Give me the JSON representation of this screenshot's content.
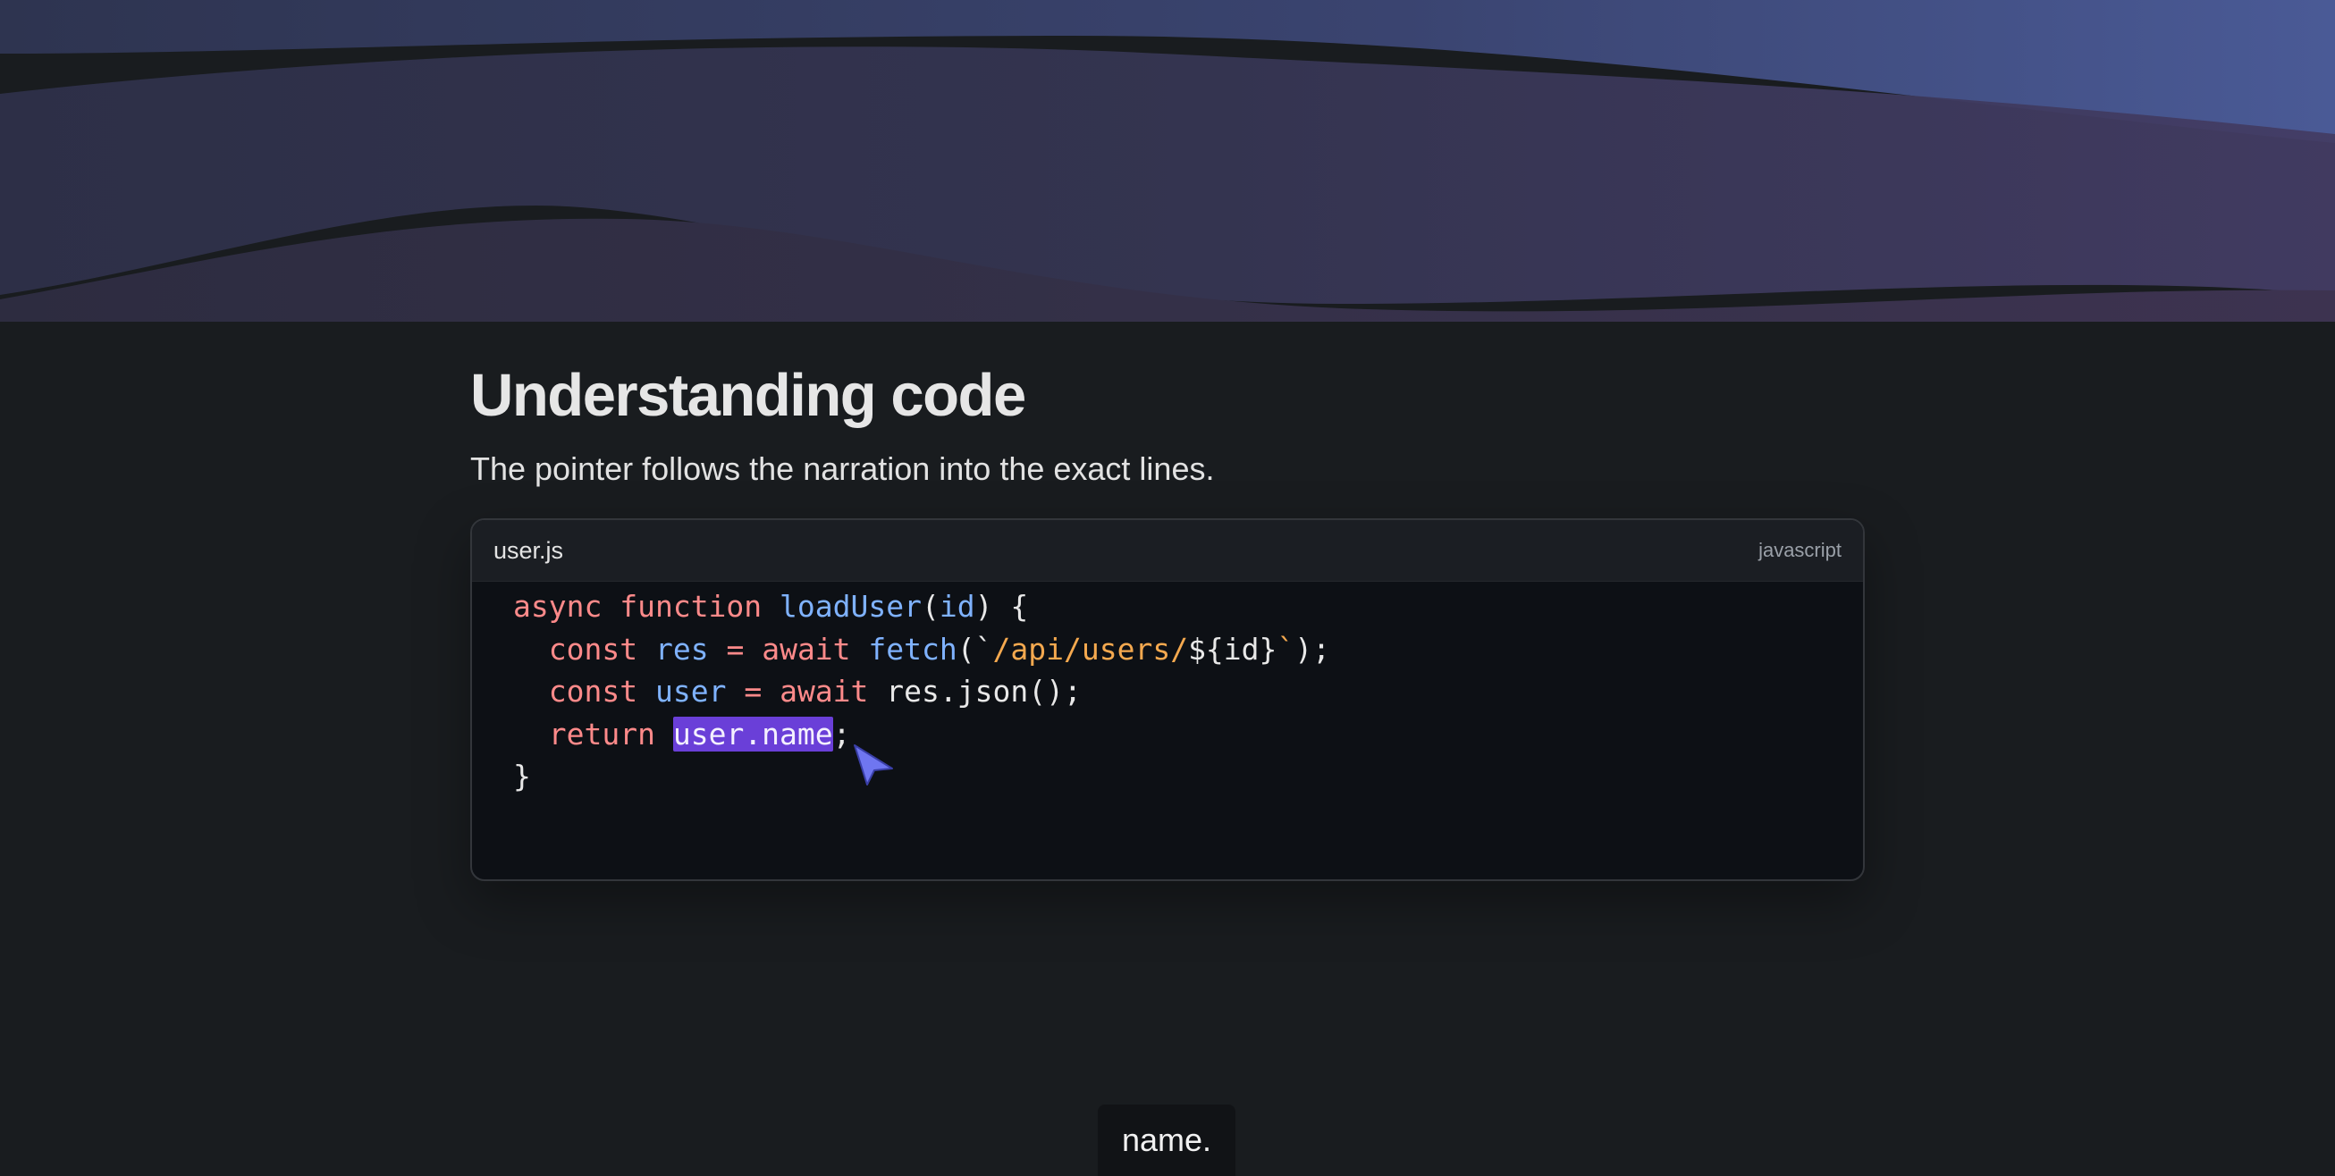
{
  "page": {
    "title": "Understanding code",
    "subtitle": "The pointer follows the narration into the exact lines."
  },
  "code_block": {
    "filename": "user.js",
    "language": "javascript",
    "highlighted_text": "user.name",
    "lines": [
      [
        {
          "t": "async",
          "c": "kw"
        },
        {
          "t": " ",
          "c": "pl"
        },
        {
          "t": "function",
          "c": "kw"
        },
        {
          "t": " ",
          "c": "pl"
        },
        {
          "t": "loadUser",
          "c": "fn"
        },
        {
          "t": "(",
          "c": "pl"
        },
        {
          "t": "id",
          "c": "id"
        },
        {
          "t": ") {",
          "c": "pl"
        }
      ],
      [
        {
          "t": "  ",
          "c": "pl"
        },
        {
          "t": "const",
          "c": "kw"
        },
        {
          "t": " ",
          "c": "pl"
        },
        {
          "t": "res",
          "c": "id"
        },
        {
          "t": " ",
          "c": "pl"
        },
        {
          "t": "=",
          "c": "kw"
        },
        {
          "t": " ",
          "c": "pl"
        },
        {
          "t": "await",
          "c": "kw"
        },
        {
          "t": " ",
          "c": "pl"
        },
        {
          "t": "fetch",
          "c": "fn"
        },
        {
          "t": "(`",
          "c": "pl"
        },
        {
          "t": "/api/users/",
          "c": "str"
        },
        {
          "t": "${id}",
          "c": "pl"
        },
        {
          "t": "`",
          "c": "str"
        },
        {
          "t": ");",
          "c": "pl"
        }
      ],
      [
        {
          "t": "  ",
          "c": "pl"
        },
        {
          "t": "const",
          "c": "kw"
        },
        {
          "t": " ",
          "c": "pl"
        },
        {
          "t": "user",
          "c": "id"
        },
        {
          "t": " ",
          "c": "pl"
        },
        {
          "t": "=",
          "c": "kw"
        },
        {
          "t": " ",
          "c": "pl"
        },
        {
          "t": "await",
          "c": "kw"
        },
        {
          "t": " ",
          "c": "pl"
        },
        {
          "t": "res.json();",
          "c": "pl"
        }
      ],
      [
        {
          "t": "  ",
          "c": "pl"
        },
        {
          "t": "return",
          "c": "kw"
        },
        {
          "t": " ",
          "c": "pl"
        },
        {
          "t": "user.name",
          "c": "hl"
        },
        {
          "t": ";",
          "c": "pl"
        }
      ],
      [
        {
          "t": "}",
          "c": "pl"
        }
      ]
    ]
  },
  "caption": {
    "text": "name."
  },
  "icons": {
    "pointer": "cursor-arrow-icon"
  },
  "colors": {
    "keyword": "#ff8a8a",
    "function": "#7fb2ff",
    "string": "#f5a94f",
    "highlight": "#6a3fd8",
    "cursor": "#6f76f0"
  }
}
